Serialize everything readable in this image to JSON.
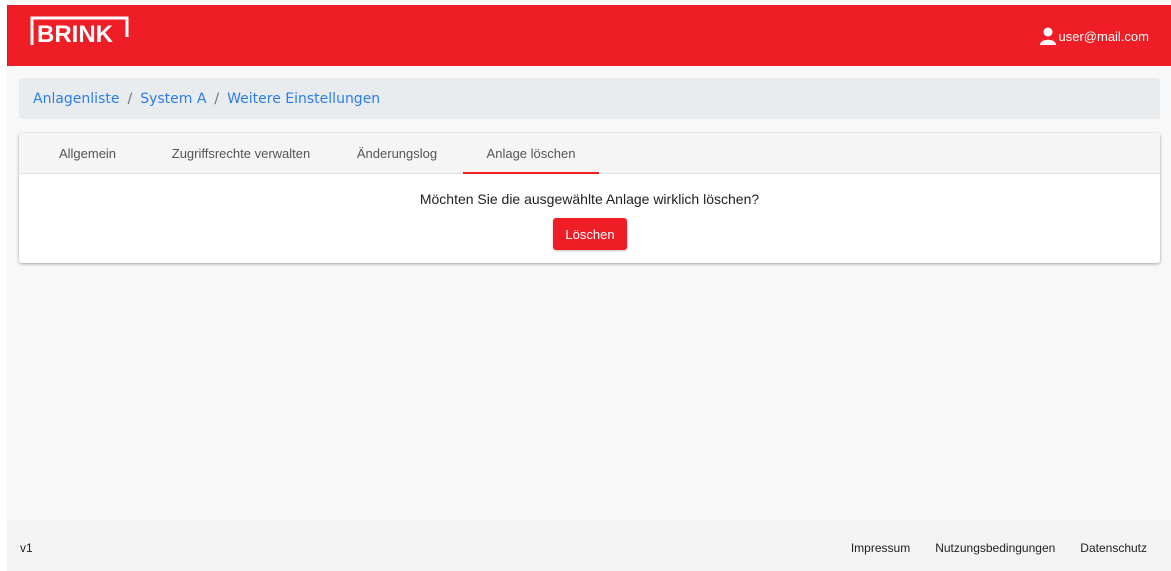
{
  "header": {
    "logo_text": "BRINK",
    "user_email": "user@mail.com",
    "user_icon": "user-icon"
  },
  "breadcrumb": {
    "items": [
      "Anlagenliste",
      "System A",
      "Weitere Einstellungen"
    ],
    "separator": "/"
  },
  "tabs": [
    {
      "label": "Allgemein",
      "active": false
    },
    {
      "label": "Zugriffsrechte verwalten",
      "active": false
    },
    {
      "label": "Änderungslog",
      "active": false
    },
    {
      "label": "Anlage löschen",
      "active": true
    }
  ],
  "delete_panel": {
    "question": "Möchten Sie die ausgewählte Anlage wirklich löschen?",
    "button_label": "Löschen"
  },
  "footer": {
    "version": "v1",
    "links": [
      "Impressum",
      "Nutzungsbedingungen",
      "Datenschutz"
    ]
  },
  "colors": {
    "brand": "#ee1d26",
    "link": "#2b7de9",
    "breadcrumb_bg": "#e9ecef"
  }
}
